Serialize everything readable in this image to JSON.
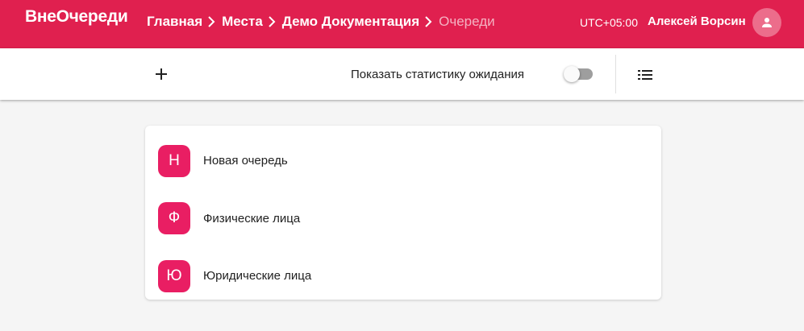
{
  "header": {
    "logo": "ВнеОчереди",
    "breadcrumb": [
      {
        "label": "Главная"
      },
      {
        "label": "Места"
      },
      {
        "label": "Демо Документация"
      },
      {
        "label": "Очереди"
      }
    ],
    "timezone": "UTC+05:00",
    "user_name": "Алексей Ворсин",
    "avatar_icon": "account-icon"
  },
  "toolbar": {
    "add_icon": "plus-icon",
    "stats_label": "Показать статистику ожидания",
    "stats_toggle_on": false,
    "list_icon": "list-icon"
  },
  "queues": [
    {
      "initial": "Н",
      "name": "Новая очередь"
    },
    {
      "initial": "Ф",
      "name": "Физические лица"
    },
    {
      "initial": "Ю",
      "name": "Юридические лица"
    }
  ],
  "colors": {
    "brand": "#e0204f",
    "queue_avatar": "#e91e63",
    "background": "#f5f5f5"
  }
}
